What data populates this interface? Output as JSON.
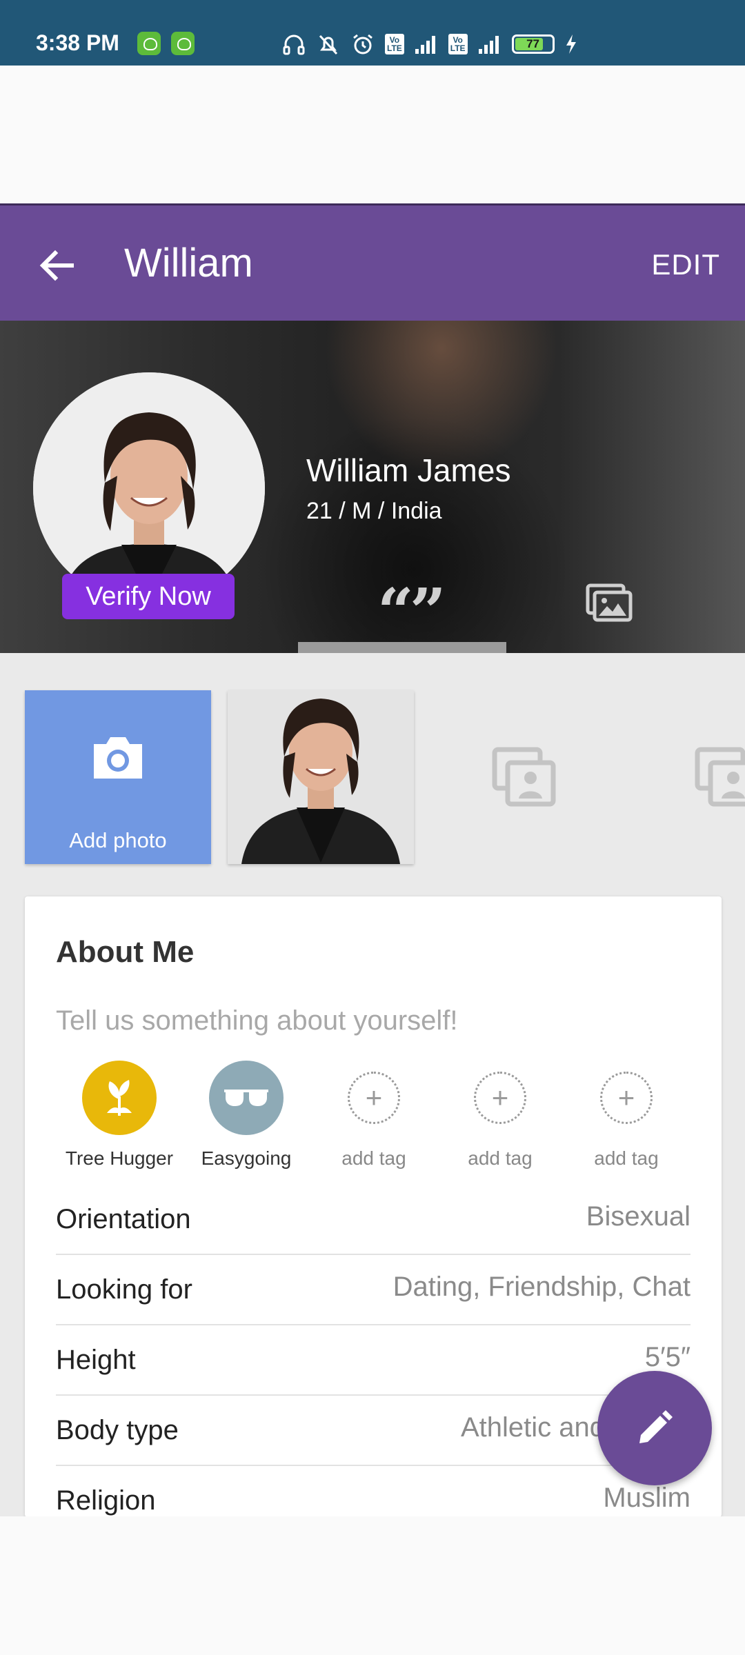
{
  "status_bar": {
    "time": "3:38 PM",
    "battery": "77",
    "vo_label": "Vo\nLTE"
  },
  "toolbar": {
    "title": "William",
    "edit_label": "EDIT"
  },
  "profile": {
    "name": "William James",
    "details": "21 / M / India",
    "verify_label": "Verify Now"
  },
  "photos": {
    "add_photo_label": "Add photo"
  },
  "about": {
    "title": "About Me",
    "placeholder": "Tell us something about yourself!",
    "tags": [
      {
        "label": "Tree Hugger",
        "icon": "tree-hugger-icon",
        "color": "#e8b80a"
      },
      {
        "label": "Easygoing",
        "icon": "sunglasses-icon",
        "color": "#8eaab6"
      },
      {
        "label": "add tag"
      },
      {
        "label": "add tag"
      },
      {
        "label": "add tag"
      }
    ]
  },
  "details": [
    {
      "label": "Orientation",
      "value": "Bisexual"
    },
    {
      "label": "Looking for",
      "value": "Dating, Friendship, Chat"
    },
    {
      "label": "Height",
      "value": "5′5″"
    },
    {
      "label": "Body type",
      "value": "Athletic and"
    },
    {
      "label": "Religion",
      "value": "Muslim"
    }
  ],
  "colors": {
    "status_bar": "#215777",
    "toolbar": "#6a4b96",
    "verify": "#8630e0",
    "add_photo": "#7198e2"
  }
}
